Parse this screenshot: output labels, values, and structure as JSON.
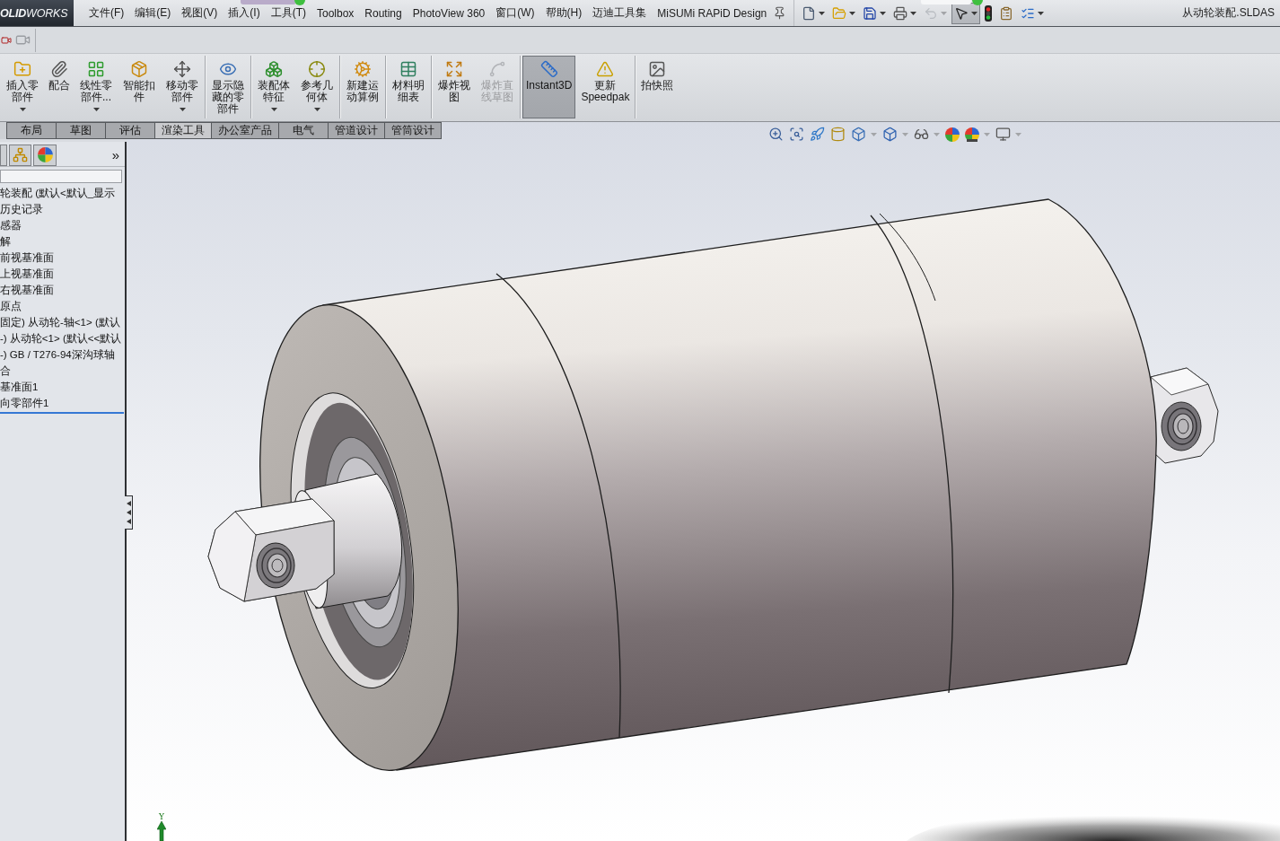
{
  "app": {
    "logo": "**OLID**WORKS",
    "menu": [
      "文件(F)",
      "编辑(E)",
      "视图(V)",
      "插入(I)",
      "工具(T)",
      "Toolbox",
      "Routing",
      "PhotoView 360",
      "窗口(W)",
      "帮助(H)",
      "迈迪工具集",
      "MiSUMi RAPiD Design"
    ],
    "document_title": "从动轮装配.SLDAS"
  },
  "quick_toolbar": [
    {
      "dropdown": true,
      "selected": false,
      "disabled": false
    },
    {
      "dropdown": true,
      "selected": false,
      "disabled": false
    },
    {
      "dropdown": true,
      "selected": false,
      "disabled": false
    },
    {
      "dropdown": true,
      "selected": false,
      "disabled": false
    },
    {
      "dropdown": true,
      "selected": false,
      "disabled": true
    },
    {
      "dropdown": true,
      "selected": true,
      "disabled": false
    },
    {
      "dropdown": false,
      "selected": false,
      "disabled": false
    },
    {
      "dropdown": false,
      "selected": false,
      "disabled": false
    },
    {
      "dropdown": true,
      "selected": false,
      "disabled": false
    }
  ],
  "ribbon": {
    "groups": [
      {
        "buttons": [
          {
            "label": "插入零部件",
            "dropdown": true,
            "selected": false,
            "disabled": false
          },
          {
            "label": "配合",
            "dropdown": false,
            "selected": false,
            "disabled": false
          },
          {
            "label": "线性零部件...",
            "dropdown": true,
            "selected": false,
            "disabled": false
          },
          {
            "label": "智能扣件",
            "dropdown": false,
            "selected": false,
            "disabled": false
          },
          {
            "label": "移动零部件",
            "dropdown": true,
            "selected": false,
            "disabled": false
          }
        ]
      },
      {
        "buttons": [
          {
            "label": "显示隐藏的零部件",
            "dropdown": false,
            "selected": false,
            "disabled": false
          }
        ]
      },
      {
        "buttons": [
          {
            "label": "装配体特征",
            "dropdown": true,
            "selected": false,
            "disabled": false
          },
          {
            "label": "参考几何体",
            "dropdown": true,
            "selected": false,
            "disabled": false
          }
        ]
      },
      {
        "buttons": [
          {
            "label": "新建运动算例",
            "dropdown": false,
            "selected": false,
            "disabled": false
          }
        ]
      },
      {
        "buttons": [
          {
            "label": "材料明细表",
            "dropdown": false,
            "selected": false,
            "disabled": false
          }
        ]
      },
      {
        "buttons": [
          {
            "label": "爆炸视图",
            "dropdown": false,
            "selected": false,
            "disabled": false
          },
          {
            "label": "爆炸直线草图",
            "dropdown": false,
            "selected": false,
            "disabled": true
          }
        ]
      },
      {
        "buttons": [
          {
            "label": "Instant3D",
            "dropdown": false,
            "selected": true,
            "disabled": false
          },
          {
            "label": "更新 Speedpak",
            "dropdown": false,
            "selected": false,
            "disabled": false
          }
        ]
      },
      {
        "buttons": [
          {
            "label": "拍快照",
            "dropdown": false,
            "selected": false,
            "disabled": false
          }
        ]
      }
    ]
  },
  "command_tabs": [
    {
      "label": "布局",
      "selected": false
    },
    {
      "label": "草图",
      "selected": false
    },
    {
      "label": "评估",
      "selected": false
    },
    {
      "label": "渲染工具",
      "selected": true
    },
    {
      "label": "办公室产品",
      "selected": false
    },
    {
      "label": "电气",
      "selected": false
    },
    {
      "label": "管道设计",
      "selected": false
    },
    {
      "label": "管筒设计",
      "selected": false
    }
  ],
  "feature_tree": {
    "more": "»",
    "items": [
      "轮装配 (默认<默认_显示",
      "历史记录",
      "感器",
      "解",
      "前视基准面",
      "上视基准面",
      "右视基准面",
      "原点",
      "固定) 从动轮-轴<1> (默认",
      "-) 从动轮<1> (默认<<默认",
      "-) GB / T276-94深沟球轴",
      "合",
      "基准面1",
      "向零部件1"
    ]
  },
  "view_toolbar": [
    {
      "dropdown": false
    },
    {
      "dropdown": false
    },
    {
      "dropdown": false
    },
    {
      "dropdown": false
    },
    {
      "dropdown": true
    },
    {
      "dropdown": true
    },
    {
      "dropdown": true
    },
    {
      "dropdown": false
    },
    {
      "dropdown": true
    },
    {
      "dropdown": true
    }
  ],
  "viewport": {
    "axis_label": "Y"
  }
}
